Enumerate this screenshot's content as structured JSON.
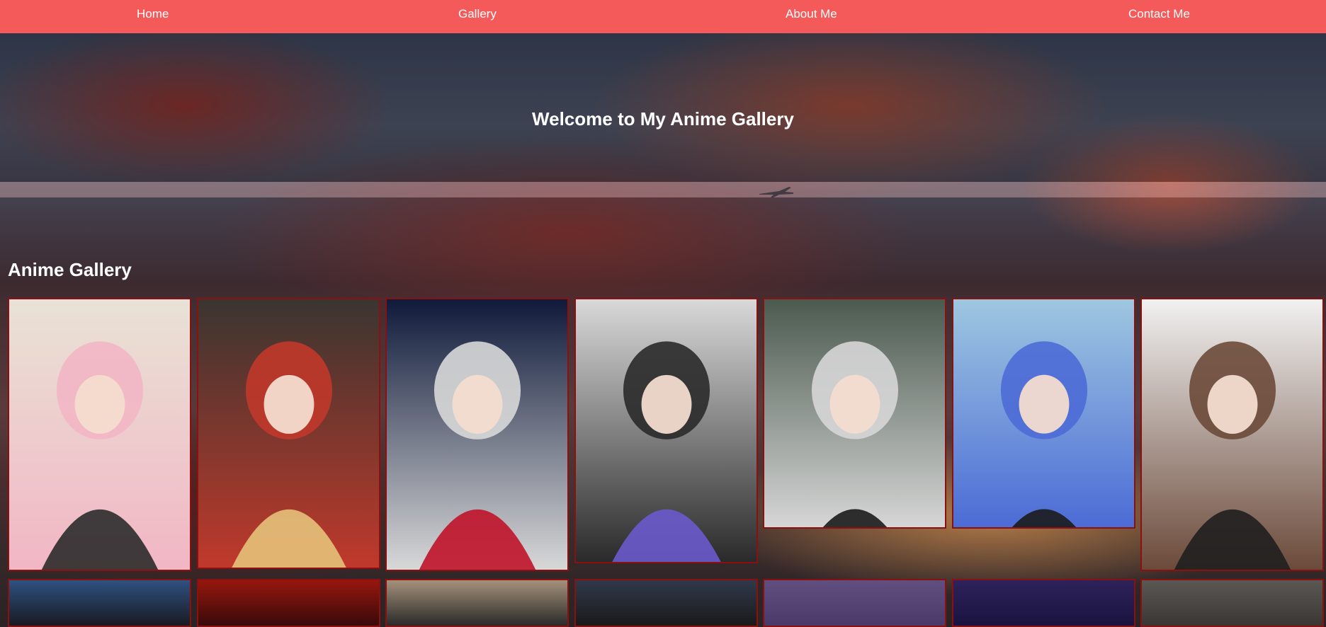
{
  "nav": {
    "items": [
      {
        "label": "Home"
      },
      {
        "label": "Gallery"
      },
      {
        "label": "About Me"
      },
      {
        "label": "Contact Me"
      }
    ]
  },
  "hero": {
    "title": "Welcome to My Anime Gallery"
  },
  "gallery": {
    "title": "Anime Gallery",
    "row1": [
      {
        "name": "pink-hair-girl-in-church",
        "palette": [
          "#e9e2d6",
          "#f2b6c4",
          "#2b2b2b"
        ]
      },
      {
        "name": "red-hair-demons-in-cell",
        "palette": [
          "#3a3530",
          "#c0392b",
          "#e6c27a"
        ]
      },
      {
        "name": "red-hair-girl-full-moon",
        "palette": [
          "#0f1a3a",
          "#d8d8d8",
          "#c0132a"
        ]
      },
      {
        "name": "robot-police-signpost",
        "palette": [
          "#d9d9d9",
          "#2a2a2a",
          "#6a5acd"
        ]
      },
      {
        "name": "masked-ninja-silver-hair",
        "palette": [
          "#4b5a4f",
          "#d6d6d6",
          "#1b1b1b"
        ]
      },
      {
        "name": "blue-hair-striped-prisoner",
        "palette": [
          "#9ec7e0",
          "#4c6bd6",
          "#1c1c1c"
        ]
      },
      {
        "name": "brown-hair-girl-black-jacket",
        "palette": [
          "#f1f1f1",
          "#6b4a3a",
          "#1f1f1f"
        ]
      }
    ],
    "row2": [
      {
        "name": "dark-hair-girl-blue-sky",
        "palette": [
          "#3b6fb3",
          "#1a1a22"
        ]
      },
      {
        "name": "red-sky-scene",
        "palette": [
          "#c81f12",
          "#3a0a0a"
        ]
      },
      {
        "name": "man-with-sunglasses",
        "palette": [
          "#e8c7a6",
          "#2a2a2a"
        ]
      },
      {
        "name": "skull-figure-dark",
        "palette": [
          "#3d4a66",
          "#1a1a1a"
        ]
      },
      {
        "name": "purple-dusk-landscape",
        "palette": [
          "#6d5c8a",
          "#4a3a6a"
        ]
      },
      {
        "name": "violet-forest-night",
        "palette": [
          "#3a2a6a",
          "#1a1440"
        ]
      },
      {
        "name": "grey-sky-birds",
        "palette": [
          "#6d6a66",
          "#3a3634"
        ]
      }
    ]
  }
}
